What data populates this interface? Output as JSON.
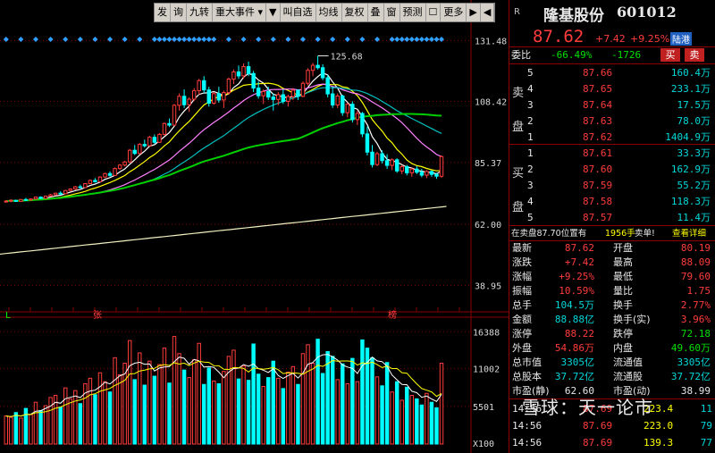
{
  "toolbar": {
    "items": [
      "发",
      "询",
      "九转",
      "重大事件 ▾",
      "▼",
      "叫自选",
      "均线",
      "复权",
      "叠",
      "窗",
      "预测",
      "☐",
      "更多",
      "▶",
      "◀"
    ]
  },
  "stock": {
    "name": "隆基股份",
    "code": "601012",
    "price": "87.62",
    "change": "+7.42",
    "change_pct": "+9.25%",
    "tag": "陆港",
    "badge": "R"
  },
  "weibi": {
    "label": "委比",
    "ratio": "-66.49%",
    "diff": "-1726",
    "sell_btn": "买",
    "buy_btn": "卖"
  },
  "ask_label": "卖盘",
  "bid_label": "买盘",
  "asks": [
    {
      "lvl": "5",
      "price": "87.66",
      "vol": "160.4万"
    },
    {
      "lvl": "4",
      "price": "87.65",
      "vol": "233.1万"
    },
    {
      "lvl": "3",
      "price": "87.64",
      "vol": "17.5万"
    },
    {
      "lvl": "2",
      "price": "87.63",
      "vol": "78.0万"
    },
    {
      "lvl": "1",
      "price": "87.62",
      "vol": "1404.9万"
    }
  ],
  "bids": [
    {
      "lvl": "1",
      "price": "87.61",
      "vol": "33.3万"
    },
    {
      "lvl": "2",
      "price": "87.60",
      "vol": "162.9万"
    },
    {
      "lvl": "3",
      "price": "87.59",
      "vol": "55.2万"
    },
    {
      "lvl": "4",
      "price": "87.58",
      "vol": "118.3万"
    },
    {
      "lvl": "5",
      "price": "87.57",
      "vol": "11.4万"
    }
  ],
  "notice": {
    "text": "在卖盘87.70位置有",
    "vol": "1956手",
    "tail": "卖单!",
    "link": "查看详细"
  },
  "stats": [
    {
      "l1": "最新",
      "v1": "87.62",
      "c1": "red",
      "l2": "开盘",
      "v2": "80.19",
      "c2": "red"
    },
    {
      "l1": "涨跌",
      "v1": "+7.42",
      "c1": "red",
      "l2": "最高",
      "v2": "88.09",
      "c2": "red"
    },
    {
      "l1": "涨幅",
      "v1": "+9.25%",
      "c1": "red",
      "l2": "最低",
      "v2": "79.60",
      "c2": "red"
    },
    {
      "l1": "振幅",
      "v1": "10.59%",
      "c1": "red",
      "l2": "量比",
      "v2": "1.75",
      "c2": "red"
    },
    {
      "l1": "总手",
      "v1": "104.5万",
      "c1": "cyan",
      "l2": "换手",
      "v2": "2.77%",
      "c2": "red"
    },
    {
      "l1": "金额",
      "v1": "88.88亿",
      "c1": "cyan",
      "l2": "换手(实)",
      "v2": "3.96%",
      "c2": "red"
    },
    {
      "l1": "涨停",
      "v1": "88.22",
      "c1": "red",
      "l2": "跌停",
      "v2": "72.18",
      "c2": "grn"
    },
    {
      "l1": "外盘",
      "v1": "54.86万",
      "c1": "red",
      "l2": "内盘",
      "v2": "49.60万",
      "c2": "grn"
    },
    {
      "l1": "总市值",
      "v1": "3305亿",
      "c1": "cyan",
      "l2": "流通值",
      "v2": "3305亿",
      "c2": "cyan"
    },
    {
      "l1": "总股本",
      "v1": "37.72亿",
      "c1": "cyan",
      "l2": "流通股",
      "v2": "37.72亿",
      "c2": "cyan"
    },
    {
      "l1": "市盈(静)",
      "v1": "62.60",
      "c1": "wht",
      "l2": "市盈(动)",
      "v2": "38.99",
      "c2": "wht"
    }
  ],
  "ticks": [
    {
      "t": "14:56",
      "p": "87.69",
      "v": "223.4",
      "d": "11"
    },
    {
      "t": "14:56",
      "p": "87.69",
      "v": "223.0",
      "d": "79"
    },
    {
      "t": "14:56",
      "p": "87.69",
      "v": "139.3",
      "d": "77"
    }
  ],
  "watermark": "雪球：天一论市",
  "price_axis": [
    "131.48",
    "108.42",
    "85.37",
    "62.00",
    "38.95"
  ],
  "vol_axis": [
    "16388",
    "11002",
    "5501",
    "X100"
  ],
  "price_marker": "125.68",
  "chart_marks": {
    "l": "L",
    "zhang": "张",
    "bang": "榜"
  },
  "chart_data": [
    {
      "type": "candlestick",
      "title": "",
      "y_ticks": [
        131.48,
        108.42,
        85.37,
        62.0,
        38.95
      ],
      "ylim": [
        32,
        138
      ],
      "annotation": {
        "label": "125.68",
        "value": 125.68
      },
      "candles": [
        [
          70.5,
          71.2,
          70.2,
          70.8
        ],
        [
          70.8,
          71.5,
          70.4,
          71.1
        ],
        [
          71.1,
          71.3,
          70.5,
          70.7
        ],
        [
          70.7,
          71.6,
          70.6,
          71.4
        ],
        [
          71.4,
          72.0,
          71.0,
          71.2
        ],
        [
          71.2,
          71.8,
          70.9,
          71.6
        ],
        [
          71.6,
          72.5,
          71.4,
          72.3
        ],
        [
          72.3,
          72.6,
          71.6,
          71.8
        ],
        [
          71.8,
          72.9,
          71.7,
          72.7
        ],
        [
          72.7,
          73.5,
          72.5,
          73.2
        ],
        [
          73.2,
          74.0,
          72.9,
          73.8
        ],
        [
          73.8,
          74.5,
          73.3,
          73.6
        ],
        [
          73.6,
          75.0,
          73.5,
          74.8
        ],
        [
          74.8,
          75.6,
          74.4,
          75.4
        ],
        [
          75.4,
          76.5,
          75.1,
          76.2
        ],
        [
          76.2,
          77.0,
          75.6,
          75.9
        ],
        [
          75.9,
          77.6,
          75.7,
          77.4
        ],
        [
          77.4,
          79.0,
          77.2,
          78.6
        ],
        [
          78.6,
          79.5,
          77.8,
          78.1
        ],
        [
          78.1,
          80.2,
          78.0,
          79.9
        ],
        [
          79.9,
          81.5,
          79.5,
          81.2
        ],
        [
          81.2,
          82.0,
          80.0,
          80.5
        ],
        [
          80.5,
          83.5,
          80.3,
          83.1
        ],
        [
          83.1,
          84.8,
          82.6,
          84.4
        ],
        [
          84.4,
          86.0,
          83.9,
          85.6
        ],
        [
          85.6,
          90.5,
          85.3,
          90.0
        ],
        [
          90.0,
          92.0,
          88.2,
          88.8
        ],
        [
          88.8,
          92.8,
          88.5,
          92.2
        ],
        [
          92.2,
          94.0,
          91.0,
          91.7
        ],
        [
          91.7,
          95.5,
          91.5,
          94.9
        ],
        [
          94.9,
          96.0,
          92.5,
          93.0
        ],
        [
          93.0,
          96.5,
          92.8,
          96.0
        ],
        [
          96.0,
          100.5,
          95.6,
          100.1
        ],
        [
          100.1,
          102.0,
          98.8,
          99.5
        ],
        [
          99.5,
          107.5,
          99.2,
          107.0
        ],
        [
          107.0,
          111.5,
          105.0,
          110.4
        ],
        [
          110.4,
          113.0,
          106.0,
          107.2
        ],
        [
          107.2,
          110.0,
          104.5,
          109.3
        ],
        [
          109.3,
          113.5,
          108.6,
          112.5
        ],
        [
          112.5,
          117.0,
          111.0,
          116.3
        ],
        [
          116.3,
          118.0,
          111.5,
          112.8
        ],
        [
          112.8,
          114.0,
          106.5,
          107.8
        ],
        [
          107.8,
          112.0,
          107.2,
          111.4
        ],
        [
          111.4,
          114.0,
          108.0,
          109.0
        ],
        [
          109.0,
          112.5,
          106.0,
          111.8
        ],
        [
          111.8,
          117.5,
          111.0,
          116.9
        ],
        [
          116.9,
          120.5,
          115.0,
          119.6
        ],
        [
          119.6,
          122.0,
          117.0,
          118.1
        ],
        [
          118.1,
          122.8,
          117.0,
          121.6
        ],
        [
          121.6,
          123.5,
          118.0,
          119.0
        ],
        [
          119.0,
          120.0,
          112.0,
          113.5
        ],
        [
          113.5,
          116.0,
          109.5,
          110.6
        ],
        [
          110.6,
          113.0,
          107.5,
          112.2
        ],
        [
          112.2,
          114.0,
          109.0,
          110.1
        ],
        [
          110.1,
          111.5,
          105.0,
          109.2
        ],
        [
          109.2,
          112.0,
          107.0,
          111.0
        ],
        [
          111.0,
          113.0,
          107.5,
          108.5
        ],
        [
          108.5,
          111.0,
          106.5,
          110.3
        ],
        [
          110.3,
          113.5,
          109.0,
          112.7
        ],
        [
          112.7,
          113.0,
          109.0,
          110.4
        ],
        [
          110.4,
          116.0,
          110.0,
          115.3
        ],
        [
          115.3,
          121.0,
          114.5,
          120.2
        ],
        [
          120.2,
          123.0,
          118.0,
          122.1
        ],
        [
          122.1,
          125.68,
          120.5,
          121.2
        ],
        [
          121.2,
          122.5,
          116.5,
          117.4
        ],
        [
          117.4,
          118.5,
          110.0,
          111.3
        ],
        [
          111.3,
          114.0,
          106.0,
          107.1
        ],
        [
          107.1,
          111.5,
          106.0,
          110.5
        ],
        [
          110.5,
          111.0,
          103.0,
          104.2
        ],
        [
          104.2,
          108.0,
          102.5,
          107.4
        ],
        [
          107.4,
          108.5,
          100.5,
          101.6
        ],
        [
          101.6,
          105.0,
          99.5,
          103.9
        ],
        [
          103.9,
          104.5,
          95.0,
          96.2
        ],
        [
          96.2,
          99.0,
          88.0,
          89.3
        ],
        [
          89.3,
          92.0,
          83.5,
          84.6
        ],
        [
          84.6,
          89.5,
          84.0,
          88.7
        ],
        [
          88.7,
          90.0,
          85.0,
          86.1
        ],
        [
          86.1,
          88.5,
          83.0,
          84.3
        ],
        [
          84.3,
          87.0,
          82.5,
          86.4
        ],
        [
          86.4,
          87.0,
          81.5,
          82.2
        ],
        [
          82.2,
          84.5,
          81.0,
          83.8
        ],
        [
          83.8,
          84.5,
          80.5,
          81.5
        ],
        [
          81.5,
          83.5,
          80.0,
          82.9
        ],
        [
          82.9,
          84.0,
          81.0,
          81.7
        ],
        [
          81.7,
          83.0,
          79.8,
          80.6
        ],
        [
          80.6,
          82.5,
          79.5,
          82.0
        ],
        [
          82.0,
          82.4,
          80.0,
          80.9
        ],
        [
          80.9,
          81.5,
          79.2,
          80.2
        ],
        [
          80.2,
          88.09,
          79.6,
          87.62
        ]
      ]
    },
    {
      "type": "bar",
      "title": "",
      "y_ticks": [
        16388,
        11002,
        5501
      ],
      "ylim": [
        0,
        17600
      ],
      "unit": "X100",
      "values": [
        4100,
        3900,
        4600,
        3800,
        5200,
        4300,
        6100,
        4900,
        5600,
        6800,
        7100,
        5400,
        8200,
        6600,
        7800,
        5900,
        8800,
        9600,
        7200,
        10400,
        9100,
        7600,
        12600,
        10100,
        11800,
        15100,
        9400,
        13300,
        8600,
        12100,
        9900,
        11600,
        14000,
        8900,
        15700,
        13200,
        10800,
        9700,
        12300,
        14700,
        8700,
        11100,
        9200,
        8800,
        10600,
        12800,
        13700,
        9500,
        11400,
        9300,
        14600,
        10200,
        8400,
        9700,
        12100,
        9600,
        8100,
        10500,
        11300,
        8700,
        13200,
        14500,
        11800,
        15300,
        10300,
        13500,
        12800,
        9400,
        11700,
        8800,
        12500,
        9100,
        15200,
        14000,
        12600,
        9800,
        8500,
        11900,
        7600,
        9100,
        6400,
        8300,
        7100,
        6600,
        5700,
        7400,
        6100,
        5300,
        11800
      ],
      "up": [
        1,
        1,
        0,
        1,
        0,
        1,
        1,
        0,
        1,
        1,
        1,
        0,
        1,
        1,
        1,
        0,
        1,
        1,
        0,
        1,
        1,
        0,
        1,
        1,
        1,
        1,
        0,
        1,
        0,
        1,
        0,
        1,
        1,
        0,
        1,
        1,
        0,
        1,
        1,
        1,
        0,
        0,
        1,
        0,
        1,
        1,
        1,
        0,
        1,
        0,
        0,
        0,
        1,
        0,
        0,
        1,
        0,
        1,
        1,
        0,
        1,
        1,
        1,
        0,
        0,
        0,
        0,
        1,
        0,
        1,
        0,
        1,
        0,
        0,
        0,
        1,
        0,
        0,
        1,
        0,
        1,
        0,
        1,
        0,
        0,
        1,
        0,
        0,
        1
      ]
    }
  ],
  "colors": {
    "up": "#ff3c3c",
    "down": "#00ffff",
    "ma5": "#ffffff",
    "ma10": "#ffff00",
    "ma20": "#ff80ff",
    "ma30": "#00c0c0",
    "ma60": "#00d000",
    "ma250": "#f0f0c0",
    "grid": "#8b0000"
  }
}
